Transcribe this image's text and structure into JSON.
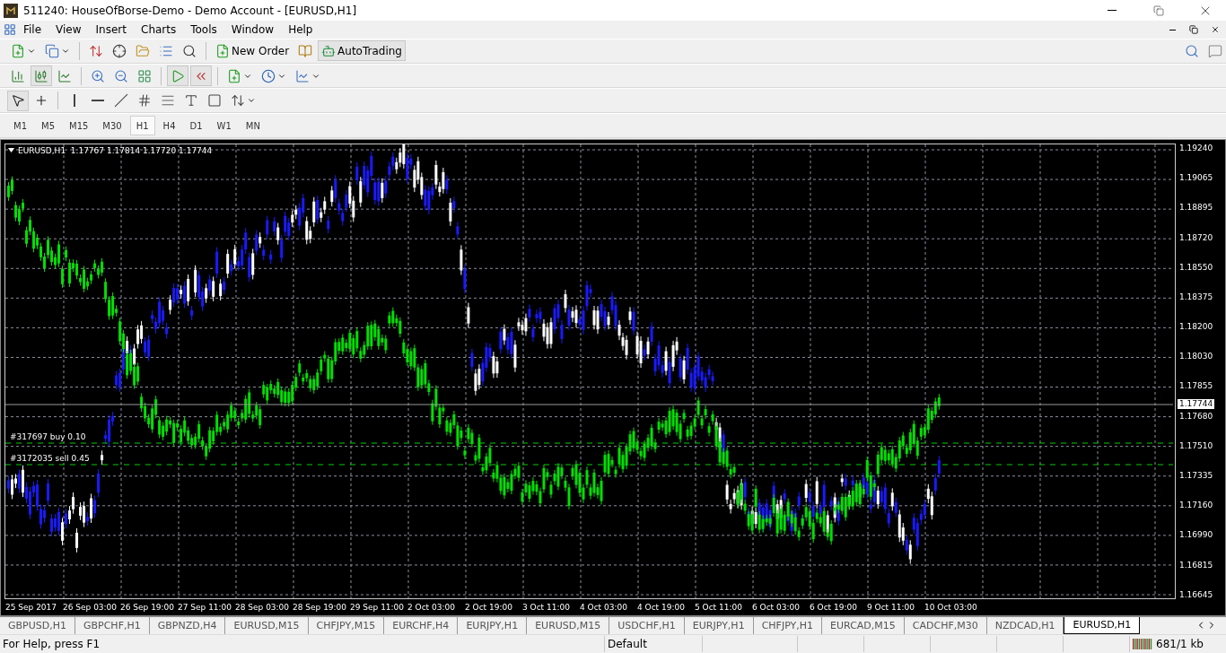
{
  "window": {
    "title": "511240: HouseOfBorse-Demo - Demo Account - [EURUSD,H1]"
  },
  "menu": [
    "File",
    "View",
    "Insert",
    "Charts",
    "Tools",
    "Window",
    "Help"
  ],
  "toolbar": {
    "new_order": "New Order",
    "auto_trading": {
      "label": "AutoTrading",
      "on": true
    }
  },
  "chart_types": [
    {
      "kind": "bars",
      "selected": false
    },
    {
      "kind": "candles",
      "selected": true
    },
    {
      "kind": "line",
      "selected": false
    }
  ],
  "chart_options": {
    "auto_scroll": true,
    "chart_shift": true
  },
  "tools": [
    {
      "kind": "cursor",
      "selected": true
    },
    {
      "kind": "crosshair",
      "selected": false
    }
  ],
  "timeframes": [
    {
      "label": "M1",
      "selected": false
    },
    {
      "label": "M5",
      "selected": false
    },
    {
      "label": "M15",
      "selected": false
    },
    {
      "label": "M30",
      "selected": false
    },
    {
      "label": "H1",
      "selected": true
    },
    {
      "label": "H4",
      "selected": false
    },
    {
      "label": "D1",
      "selected": false
    },
    {
      "label": "W1",
      "selected": false
    },
    {
      "label": "MN",
      "selected": false
    }
  ],
  "chart": {
    "header": "EURUSD,H1  1.17767 1.17814 1.17720 1.17744",
    "price_labels": [
      "1.19240",
      "1.19065",
      "1.18895",
      "1.18720",
      "1.18550",
      "1.18375",
      "1.18200",
      "1.18030",
      "1.17855",
      "1.17680",
      "1.17510",
      "1.17335",
      "1.17160",
      "1.16990",
      "1.16815",
      "1.16645"
    ],
    "current_price": "1.17744",
    "orders": [
      {
        "label": "#317697 buy 0.10"
      },
      {
        "label": "#3172035 sell 0.45"
      }
    ],
    "time_labels": [
      "25 Sep 2017",
      "26 Sep 03:00",
      "26 Sep 19:00",
      "27 Sep 11:00",
      "28 Sep 03:00",
      "28 Sep 19:00",
      "29 Sep 11:00",
      "2 Oct 03:00",
      "2 Oct 19:00",
      "3 Oct 11:00",
      "4 Oct 03:00",
      "4 Oct 19:00",
      "5 Oct 11:00",
      "6 Oct 03:00",
      "6 Oct 19:00",
      "9 Oct 11:00",
      "10 Oct 03:00"
    ]
  },
  "tabs": [
    {
      "label": "GBPUSD,H1",
      "selected": false
    },
    {
      "label": "GBPCHF,H1",
      "selected": false
    },
    {
      "label": "GBPNZD,H4",
      "selected": false
    },
    {
      "label": "EURUSD,M15",
      "selected": false
    },
    {
      "label": "CHFJPY,M15",
      "selected": false
    },
    {
      "label": "EURCHF,H4",
      "selected": false
    },
    {
      "label": "EURJPY,H1",
      "selected": false
    },
    {
      "label": "EURUSD,M15",
      "selected": false
    },
    {
      "label": "USDCHF,H1",
      "selected": false
    },
    {
      "label": "EURJPY,H1",
      "selected": false
    },
    {
      "label": "CHFJPY,H1",
      "selected": false
    },
    {
      "label": "EURCAD,M15",
      "selected": false
    },
    {
      "label": "CADCHF,M30",
      "selected": false
    },
    {
      "label": "NZDCAD,H1",
      "selected": false
    },
    {
      "label": "EURUSD,H1",
      "selected": true
    }
  ],
  "status_bar": {
    "help": "For Help, press F1",
    "profile": "Default",
    "traffic": "681/1 kb"
  }
}
